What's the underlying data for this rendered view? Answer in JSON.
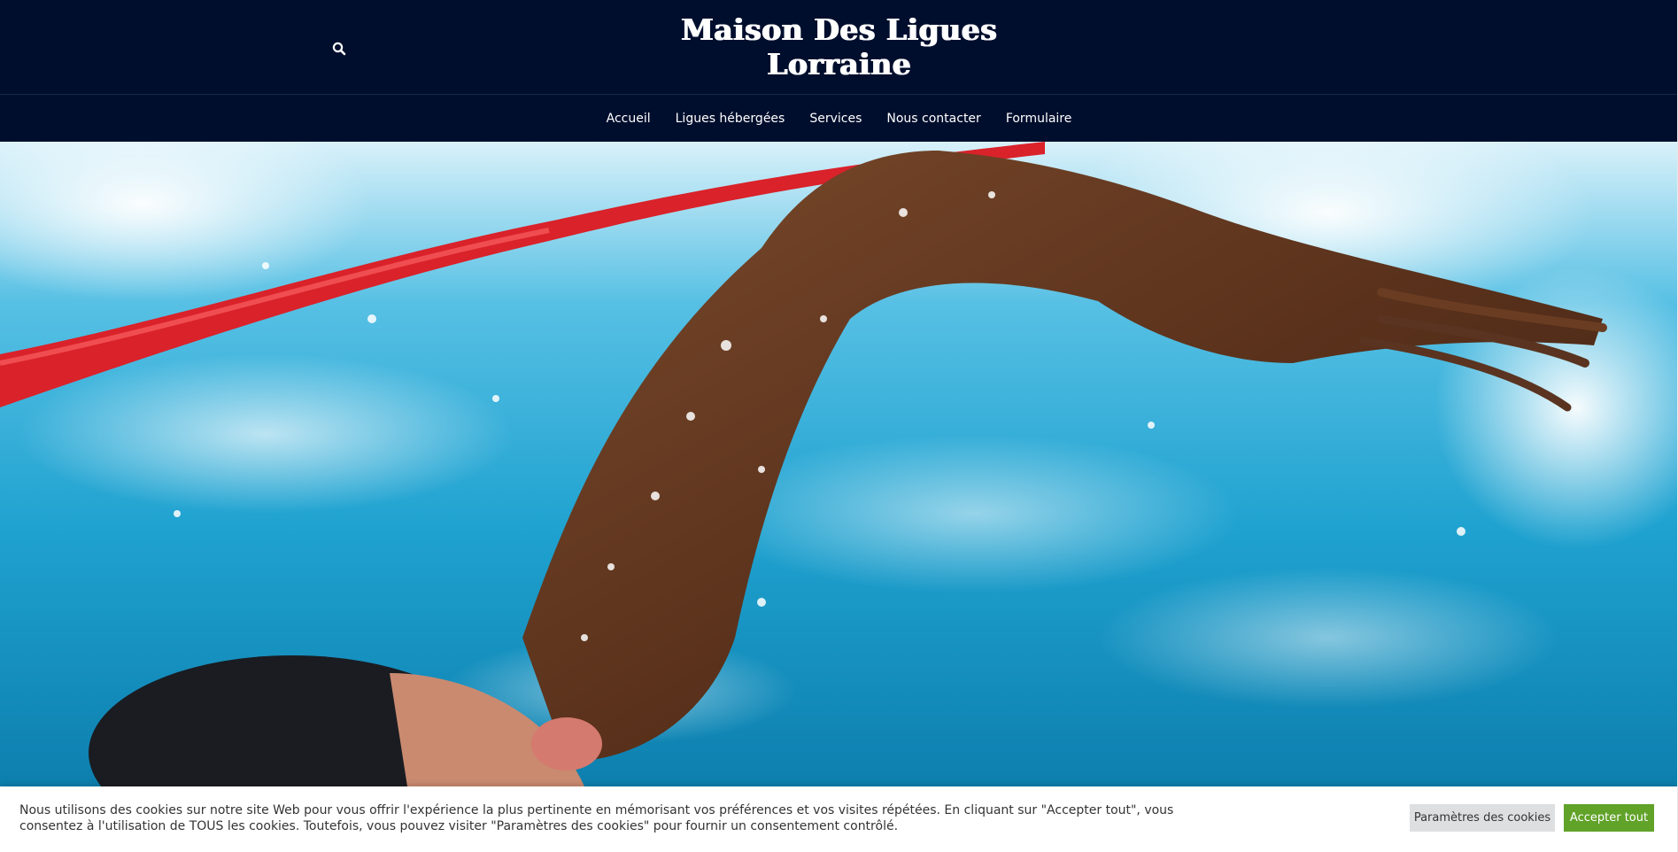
{
  "header": {
    "title_line1": "Maison Des Ligues",
    "title_line2": "Lorraine",
    "search_icon": "search-icon",
    "background_color": "#000e2d"
  },
  "nav": {
    "items": [
      {
        "label": "Accueil"
      },
      {
        "label": "Ligues hébergées"
      },
      {
        "label": "Services"
      },
      {
        "label": "Nous contacter"
      },
      {
        "label": "Formulaire"
      }
    ]
  },
  "cookie_banner": {
    "text": "Nous utilisons des cookies sur notre site Web pour vous offrir l'expérience la plus pertinente en mémorisant vos préférences et vos visites répétées. En cliquant sur \"Accepter tout\", vous consentez à l'utilisation de TOUS les cookies. Toutefois, vous pouvez visiter \"Paramètres des cookies\" pour fournir un consentement contrôlé.",
    "settings_label": "Paramètres des cookies",
    "accept_label": "Accepter tout",
    "accept_color": "#61a229",
    "settings_color": "#dedfe0"
  }
}
